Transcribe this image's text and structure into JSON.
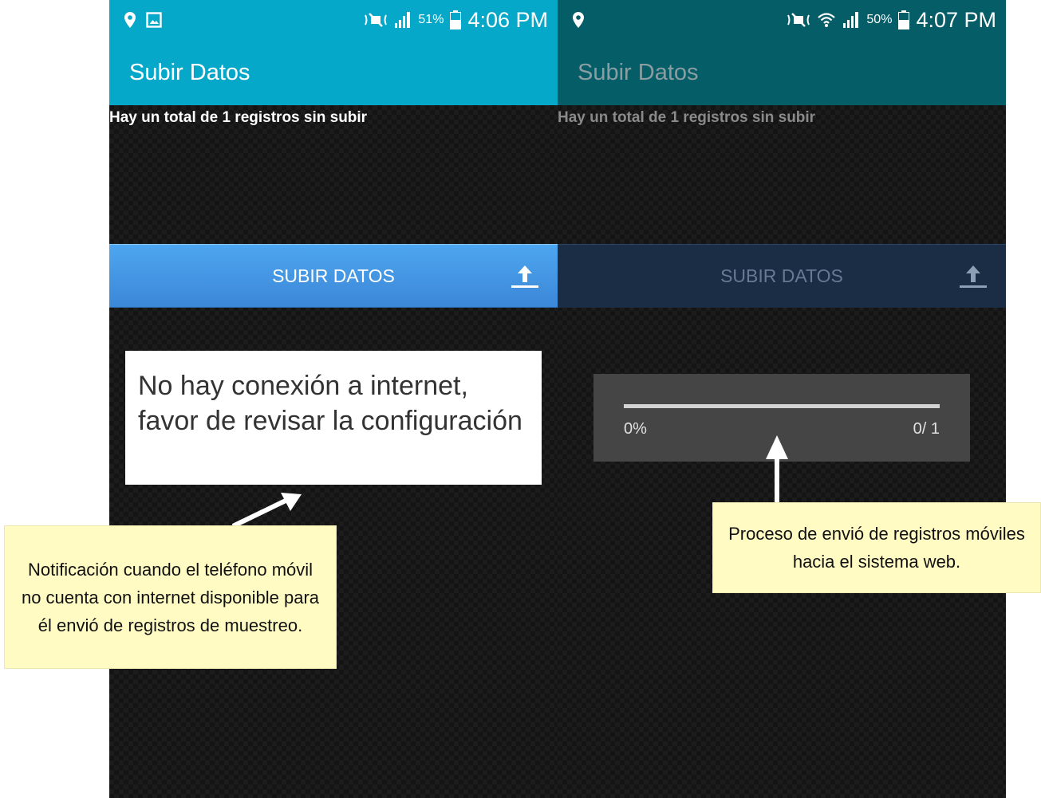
{
  "left_screen": {
    "status": {
      "battery_pct": "51%",
      "time": "4:06 PM"
    },
    "app_title": "Subir Datos",
    "pending_text": "Hay un total de 1 registros sin subir",
    "upload_button_label": "SUBIR DATOS",
    "toast_message": "No hay conexión a internet, favor de revisar la configuración"
  },
  "right_screen": {
    "status": {
      "battery_pct": "50%",
      "time": "4:07 PM"
    },
    "app_title": "Subir Datos",
    "pending_text": "Hay un total de 1 registros sin subir",
    "upload_button_label": "SUBIR DATOS",
    "progress": {
      "percent_label": "0%",
      "count_label": "0/ 1",
      "value": 0
    }
  },
  "annotations": {
    "left_note": "Notificación cuando el teléfono móvil no cuenta con internet disponible para él envió de registros de muestreo.",
    "right_note": "Proceso de envió de registros móviles hacia el sistema web."
  },
  "colors": {
    "left_app_bar": "#05a8c8",
    "right_app_bar": "#045d67",
    "left_button": "#4199e2",
    "right_button": "#1b2c45",
    "note_background": "#fffbc3"
  }
}
